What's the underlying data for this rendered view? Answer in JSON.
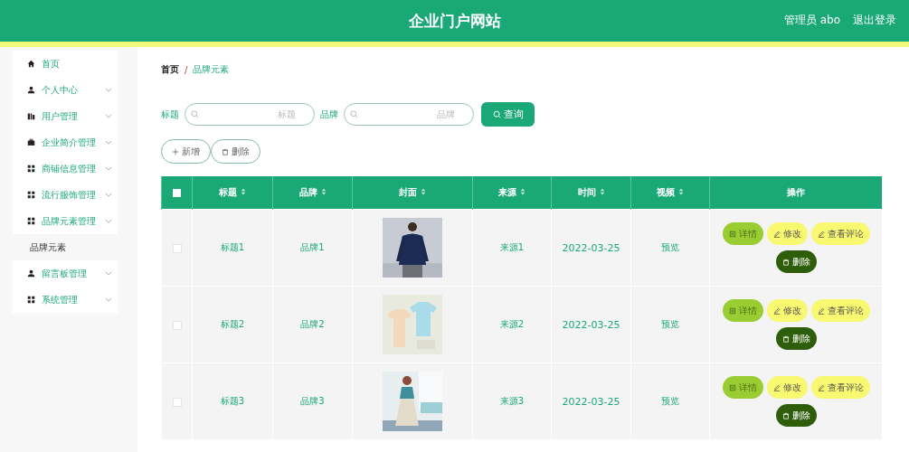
{
  "header": {
    "title": "企业门户网站",
    "user": "管理员 abo",
    "logout": "退出登录"
  },
  "sidebar": {
    "items": [
      {
        "label": "首页",
        "kind": "link"
      },
      {
        "label": "个人中心",
        "kind": "submenu"
      },
      {
        "label": "用户管理",
        "kind": "submenu"
      },
      {
        "label": "企业简介管理",
        "kind": "submenu"
      },
      {
        "label": "商铺信息管理",
        "kind": "submenu"
      },
      {
        "label": "流行服饰管理",
        "kind": "submenu"
      },
      {
        "label": "品牌元素管理",
        "kind": "submenu",
        "children": [
          {
            "label": "品牌元素"
          }
        ]
      },
      {
        "label": "留言板管理",
        "kind": "submenu"
      },
      {
        "label": "系统管理",
        "kind": "submenu"
      }
    ]
  },
  "breadcrumb": {
    "items": [
      "首页",
      "品牌元素"
    ],
    "separator": "/"
  },
  "search": {
    "fields": [
      {
        "label": "标题",
        "placeholder": "标题"
      },
      {
        "label": "品牌",
        "placeholder": "品牌"
      }
    ],
    "button": "查询"
  },
  "actions": [
    {
      "label": "新增"
    },
    {
      "label": "删除"
    }
  ],
  "table": {
    "select_all_checked": false,
    "columns": [
      {
        "label": "标题",
        "sortable": true
      },
      {
        "label": "品牌",
        "sortable": true
      },
      {
        "label": "封面",
        "sortable": true
      },
      {
        "label": "来源",
        "sortable": true
      },
      {
        "label": "时间",
        "sortable": true
      },
      {
        "label": "视频",
        "sortable": true
      },
      {
        "label": "操作",
        "sortable": false
      }
    ],
    "rows": [
      {
        "checked": false,
        "title": "标题1",
        "brand": "品牌1",
        "source": "来源1",
        "time": "2022-03-25",
        "video": "预览",
        "actions": [
          "详情",
          "修改",
          "查看评论",
          "删除"
        ]
      },
      {
        "checked": false,
        "title": "标题2",
        "brand": "品牌2",
        "source": "来源2",
        "time": "2022-03-25",
        "video": "预览",
        "actions": [
          "详情",
          "修改",
          "查看评论",
          "删除"
        ]
      },
      {
        "checked": false,
        "title": "标题3",
        "brand": "品牌3",
        "source": "来源3",
        "time": "2022-03-25",
        "video": "预览",
        "actions": [
          "详情",
          "修改",
          "查看评论",
          "删除"
        ]
      }
    ]
  }
}
